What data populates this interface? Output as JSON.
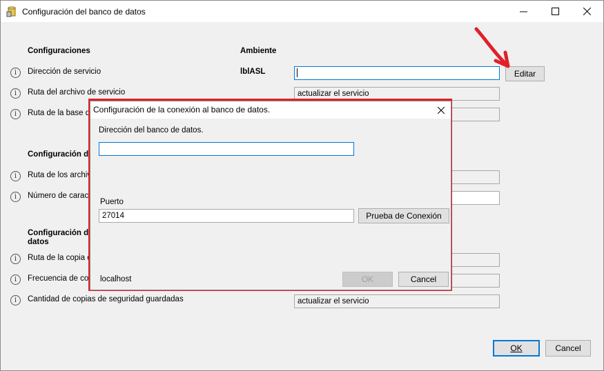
{
  "window": {
    "title": "Configuración del banco de datos",
    "icon": "database-icon"
  },
  "headers": {
    "config": "Configuraciones",
    "env": "Ambiente",
    "section2": "Configuración d",
    "section3_line1": "Configuración d",
    "section3_line2": "datos"
  },
  "rows": [
    {
      "label": "Dirección de servicio"
    },
    {
      "label": "Ruta del archivo de servicio"
    },
    {
      "label": "Ruta de la base de"
    },
    {
      "label": "Ruta de los archivo"
    },
    {
      "label": "Número de caracte"
    },
    {
      "label": "Ruta de la copia d"
    },
    {
      "label": "Frecuencia de cop"
    },
    {
      "label": "Cantidad de copias de seguridad guardadas"
    }
  ],
  "env_label": "lblASL",
  "fields": {
    "service_path": "actualizar el servicio",
    "backup_count": "actualizar el servicio"
  },
  "buttons": {
    "edit": "Editar",
    "ok": "OK",
    "cancel": "Cancel"
  },
  "dialog": {
    "title": "Configuración de la conexión al banco de datos.",
    "address_label": "Dirección del banco de datos.",
    "address_value": "",
    "port_label": "Puerto",
    "port_value": "27014",
    "test_button": "Prueba de Conexión",
    "host_label": "localhost",
    "ok_button": "OK",
    "cancel_button": "Cancel"
  },
  "colors": {
    "highlight": "#e0202a",
    "focus": "#0078d7"
  }
}
